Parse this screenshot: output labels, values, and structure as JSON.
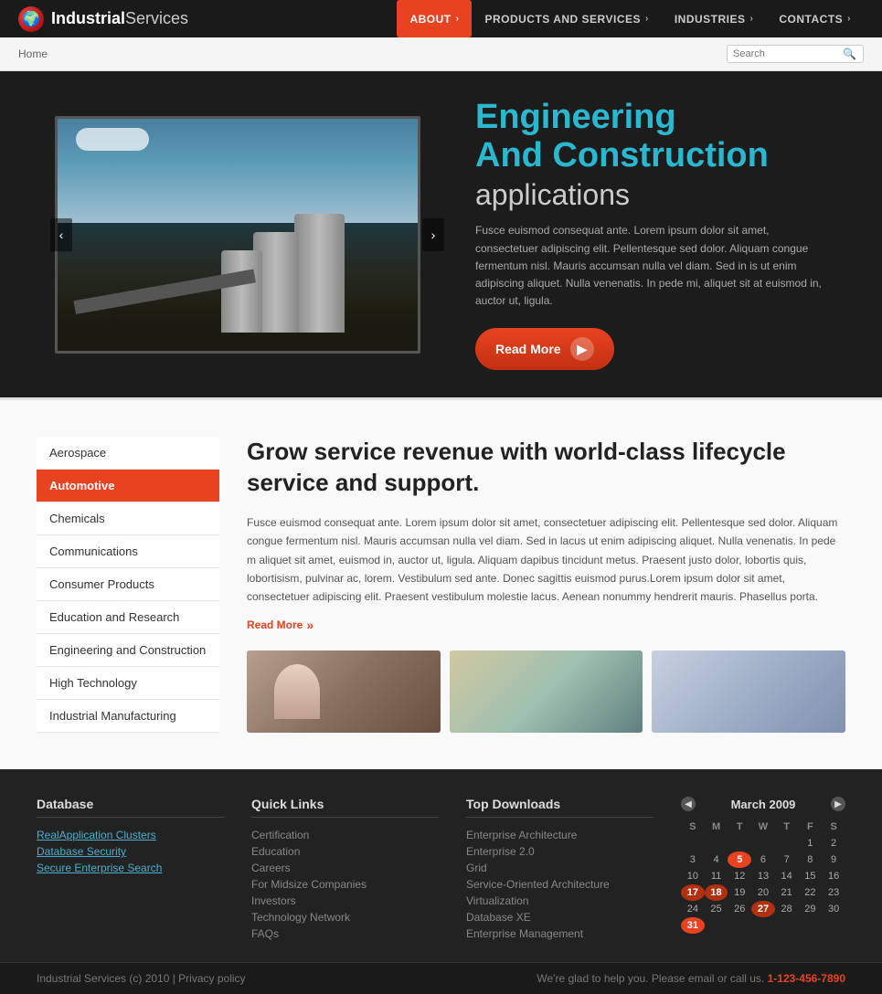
{
  "header": {
    "logo_industrial": "Industrial",
    "logo_services": "Services",
    "nav": [
      {
        "label": "ABOUT",
        "active": true,
        "chevron": "›"
      },
      {
        "label": "PRODUCTS AND SERVICES",
        "active": false,
        "chevron": "›"
      },
      {
        "label": "INDUSTRIES",
        "active": false,
        "chevron": "›"
      },
      {
        "label": "CONTACTS",
        "active": false,
        "chevron": "›"
      }
    ]
  },
  "breadcrumb": {
    "home": "Home",
    "search_placeholder": "Search"
  },
  "hero": {
    "title_line1": "Engineering",
    "title_line2": "And Construction",
    "title_line3": "applications",
    "body": "Fusce euismod consequat ante. Lorem ipsum dolor sit amet, consectetuer adipiscing elit. Pellentesque sed dolor. Aliquam congue fermentum nisl. Mauris accumsan nulla vel diam. Sed in is ut enim adipiscing aliquet. Nulla venenatis. In pede mi, aliquet sit at euismod in, auctor ut, ligula.",
    "btn_label": "Read More",
    "prev": "‹",
    "next": "›"
  },
  "sidebar": {
    "items": [
      {
        "label": "Aerospace",
        "active": false
      },
      {
        "label": "Automotive",
        "active": true
      },
      {
        "label": "Chemicals",
        "active": false
      },
      {
        "label": "Communications",
        "active": false
      },
      {
        "label": "Consumer Products",
        "active": false
      },
      {
        "label": "Education and Research",
        "active": false
      },
      {
        "label": "Engineering and Construction",
        "active": false
      },
      {
        "label": "High Technology",
        "active": false
      },
      {
        "label": "Industrial Manufacturing",
        "active": false
      }
    ]
  },
  "main": {
    "heading": "Grow service revenue with world-class lifecycle service and support.",
    "body": "Fusce euismod consequat ante. Lorem ipsum dolor sit amet, consectetuer adipiscing elit. Pellentesque sed dolor. Aliquam congue fermentum nisl. Mauris accumsan nulla vel diam. Sed in lacus ut enim adipiscing aliquet. Nulla venenatis. In pede m aliquet sit amet, euismod in, auctor ut, ligula. Aliquam dapibus tincidunt metus. Praesent justo dolor, lobortis quis, lobortisism, pulvinar ac, lorem. Vestibulum sed ante. Donec sagittis euismod purus.Lorem ipsum dolor sit amet, consectetuer adipiscing elit. Praesent vestibulum molestie lacus. Aenean nonummy hendrerit mauris. Phasellus porta.",
    "read_more": "Read More"
  },
  "footer": {
    "database": {
      "title": "Database",
      "links": [
        "RealApplication Clusters",
        "Database Security",
        "Secure Enterprise Search"
      ]
    },
    "quick_links": {
      "title": "Quick Links",
      "links": [
        "Certification",
        "Education",
        "Careers",
        "For Midsize Companies",
        "Investors",
        "Technology Network",
        "FAQs"
      ]
    },
    "top_downloads": {
      "title": "Top Downloads",
      "links": [
        "Enterprise Architecture",
        "Enterprise 2.0",
        "Grid",
        "Service-Oriented Architecture",
        "Virtualization",
        "Database XE",
        "Enterprise Management"
      ]
    },
    "calendar": {
      "title": "March 2009",
      "days_header": [
        "S",
        "M",
        "T",
        "W",
        "T",
        "F",
        "S"
      ],
      "weeks": [
        [
          "",
          "",
          "",
          "",
          "",
          "",
          "1",
          "2"
        ],
        [
          "3",
          "4",
          "5",
          "6",
          "7",
          "8",
          "9"
        ],
        [
          "10",
          "11",
          "12",
          "13",
          "14",
          "15",
          "16"
        ],
        [
          "17",
          "18",
          "19",
          "20",
          "21",
          "22",
          "23"
        ],
        [
          "24",
          "25",
          "26",
          "27",
          "28",
          "29",
          "30"
        ],
        [
          "31",
          "",
          "",
          "",
          "",
          "",
          ""
        ]
      ],
      "today": "5",
      "highlighted": [
        "17",
        "18"
      ],
      "highlighted2": [
        "27"
      ],
      "end": [
        "31"
      ]
    }
  },
  "bottom_bar": {
    "copyright": "Industrial Services (c) 2010  |  Privacy policy",
    "contact_text": "We're glad to help you. Please email or call us.",
    "phone": "1-123-456-7890"
  }
}
